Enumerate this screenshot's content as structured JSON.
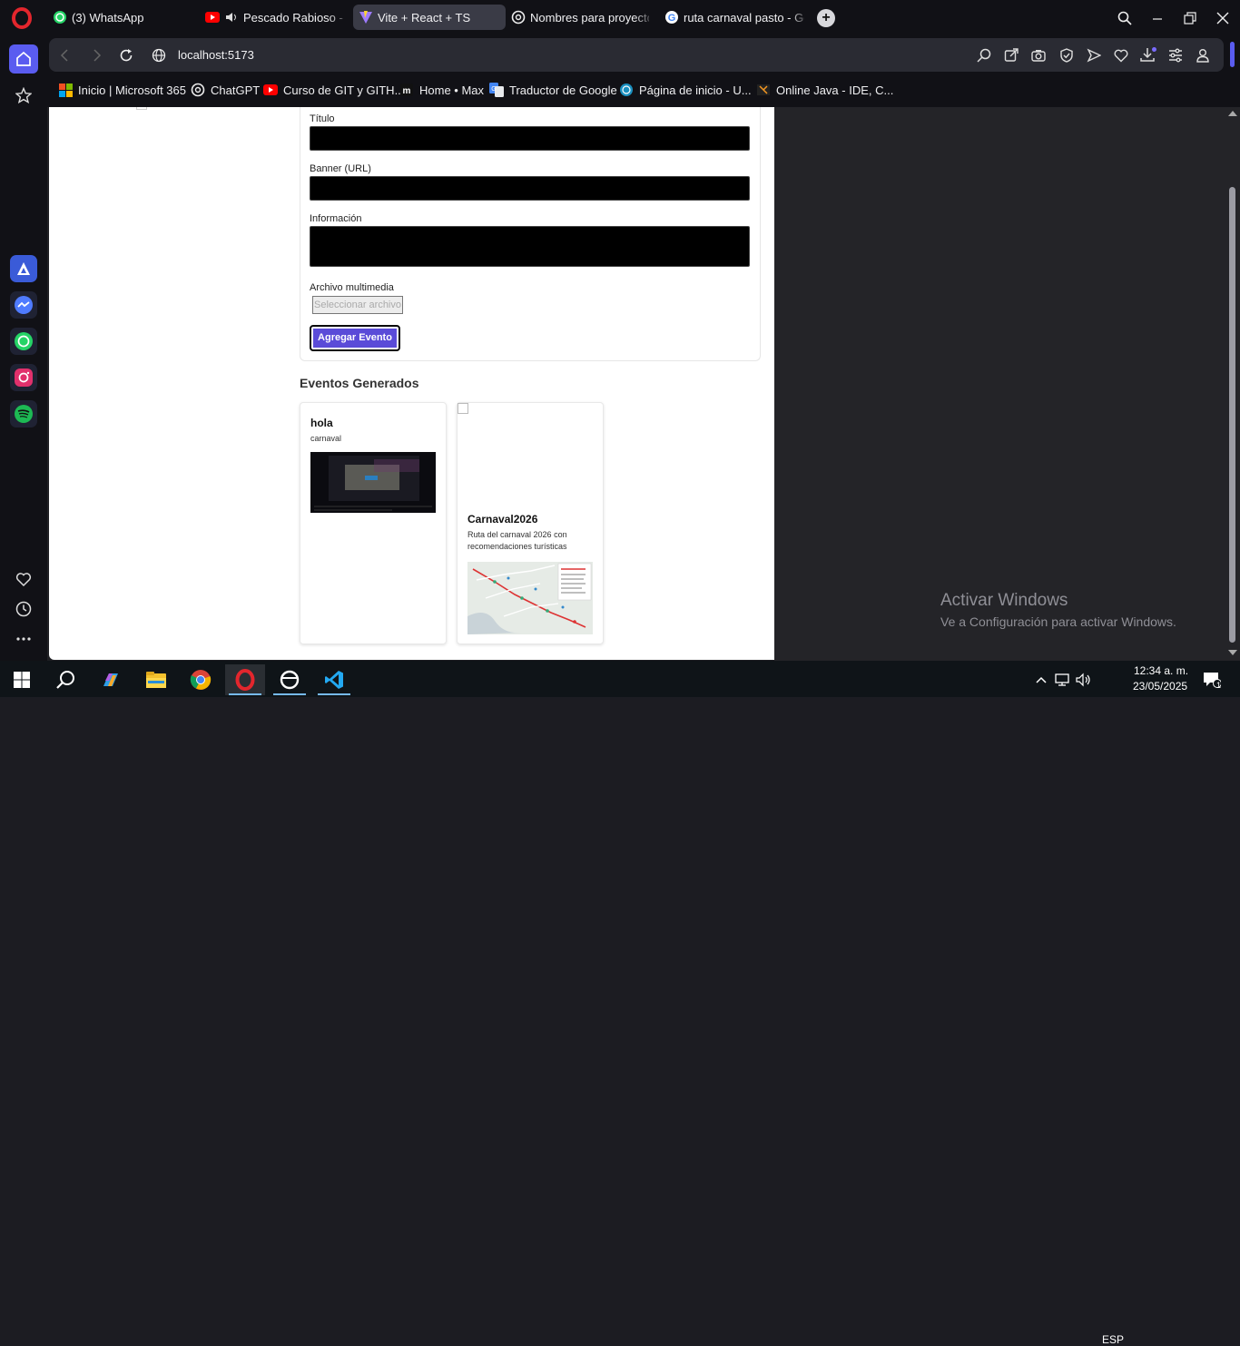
{
  "tabs": [
    {
      "label": "(3) WhatsApp",
      "icon": "whatsapp-icon",
      "active": false
    },
    {
      "label": "Pescado Rabioso - Cemento",
      "icon": "youtube-icon",
      "active": false
    },
    {
      "label": "Vite + React + TS",
      "icon": "vite-icon",
      "active": true
    },
    {
      "label": "Nombres para proyecto Carnaval",
      "icon": "openai-icon",
      "active": false
    },
    {
      "label": "ruta carnaval pasto - Google",
      "icon": "google-icon",
      "active": false
    }
  ],
  "address": {
    "url": "localhost:5173"
  },
  "bookmarks": [
    {
      "label": "Inicio | Microsoft 365",
      "icon": "microsoft-icon"
    },
    {
      "label": "ChatGPT",
      "icon": "openai-icon"
    },
    {
      "label": "Curso de GIT y GITH...",
      "icon": "youtube-icon"
    },
    {
      "label": "Home • Max",
      "icon": "max-icon"
    },
    {
      "label": "Traductor de Google",
      "icon": "translate-icon"
    },
    {
      "label": "Página de inicio - U...",
      "icon": "globe-icon"
    },
    {
      "label": "Online Java - IDE, C...",
      "icon": "java-icon"
    }
  ],
  "form": {
    "title_label": "Título",
    "banner_label": "Banner (URL)",
    "info_label": "Información",
    "media_label": "Archivo multimedia",
    "file_button": "Seleccionar archivo",
    "submit": "Agregar Evento"
  },
  "events": {
    "heading": "Eventos Generados",
    "items": [
      {
        "title": "hola",
        "description": "carnaval"
      },
      {
        "title": "Carnaval2026",
        "description": "Ruta del carnaval 2026 con recomendaciones turísticas"
      }
    ]
  },
  "watermark": {
    "title": "Activar Windows",
    "subtitle": "Ve a Configuración para activar Windows."
  },
  "taskbar": {
    "language": "ESP",
    "time": "12:34 a. m.",
    "date": "23/05/2025",
    "notifications": "1"
  },
  "colors": {
    "accent_button": "#5a4bd8",
    "opera_red": "#e3262d",
    "sidebar_active": "#5a5cf0"
  }
}
